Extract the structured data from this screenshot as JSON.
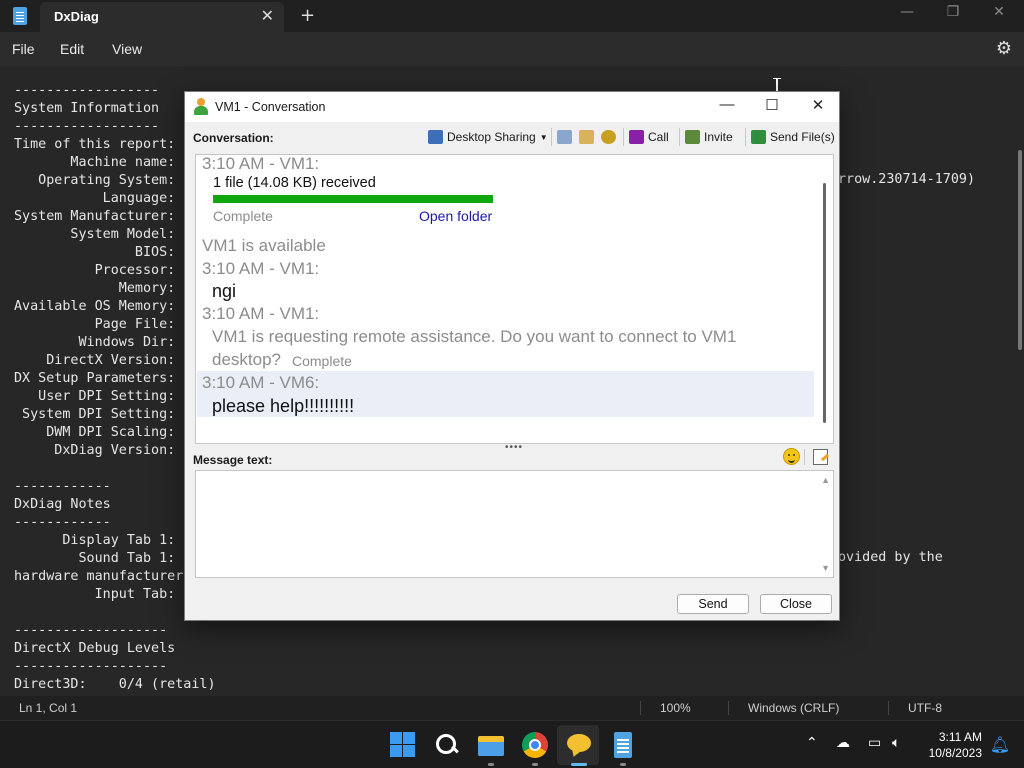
{
  "notepad": {
    "tab_title": "DxDiag",
    "menu": [
      "File",
      "Edit",
      "View"
    ],
    "left_text": "------------------\nSystem Information\n------------------\nTime of this report: \n       Machine name: \n   Operating System: \n           Language: \nSystem Manufacturer: \n       System Model: \n               BIOS: \n          Processor: \n             Memory: \nAvailable OS Memory: \n          Page File: \n        Windows Dir: \n    DirectX Version: \nDX Setup Parameters: \n   User DPI Setting: \n System DPI Setting: \n    DWM DPI Scaling: \n     DxDiag Version: \n\n------------\nDxDiag Notes\n------------\n      Display Tab 1: \n        Sound Tab 1: \nhardware manufacturer\n          Input Tab: \n\n-------------------\nDirectX Debug Levels\n-------------------\nDirect3D:    0/4 (retail)",
    "right_text_os": "rrow.230714-1709)",
    "right_text_sound": "ovided by the",
    "status": {
      "position": "Ln 1, Col 1",
      "zoom": "100%",
      "line_ending": "Windows (CRLF)",
      "encoding": "UTF-8"
    }
  },
  "taskbar": {
    "clock_time": "3:11 AM",
    "clock_date": "10/8/2023"
  },
  "conversation": {
    "title": "VM1 - Conversation",
    "conversation_label": "Conversation:",
    "toolbar": {
      "desktop_sharing": "Desktop Sharing",
      "call": "Call",
      "invite": "Invite",
      "send_files": "Send File(s)"
    },
    "messages": {
      "h1": "3:10 AM - VM1:",
      "file_received": "1 file (14.08 KB) received",
      "progress": 1.0,
      "complete1": "Complete",
      "open_folder": "Open folder",
      "available": "VM1 is available",
      "h2": "3:10 AM - VM1:",
      "msg_ngi": "ngi",
      "h3": "3:10 AM - VM1:",
      "remote_line1": "VM1 is requesting remote assistance. Do you want to connect to VM1",
      "remote_line2": "desktop?",
      "complete2": "Complete",
      "h4": "3:10 AM - VM6:",
      "msg_help": "please help!!!!!!!!!!"
    },
    "message_text_label": "Message text:",
    "message_value": "",
    "send_label": "Send",
    "close_label": "Close"
  }
}
